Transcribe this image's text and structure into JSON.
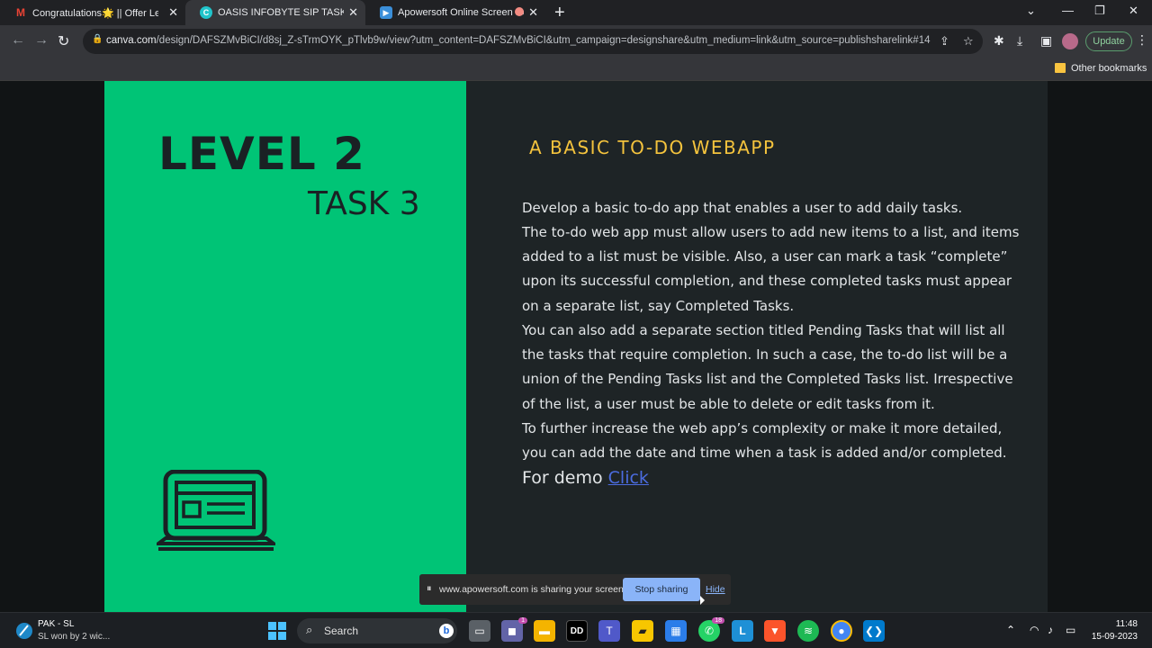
{
  "browser": {
    "tabs": [
      {
        "title": "Congratulations🌟 || Offer Letter",
        "icon": "gmail-icon",
        "active": false
      },
      {
        "title": "OASIS INFOBYTE SIP TASK LIST",
        "icon": "canva-icon",
        "active": true
      },
      {
        "title": "Apowersoft Online Screen Re",
        "icon": "apowersoft-icon",
        "active": false
      }
    ],
    "url_host": "canva.com",
    "url_path": "/design/DAFSZMvBiCI/d8sj_Z-sTrmOYK_pTlvb9w/view?utm_content=DAFSZMvBiCI&utm_campaign=designshare&utm_medium=link&utm_source=publishsharelink#14",
    "update_label": "Update",
    "bookmark_label": "Other bookmarks"
  },
  "slide": {
    "level": "LEVEL 2",
    "task": "TASK 3",
    "title": "A BASIC TO-DO WEBAPP",
    "paragraphs": [
      " Develop a basic to-do app that enables a user to add daily tasks.",
      "The to-do web app must allow users to add new items to a list, and items added to a list must be visible. Also, a user can mark a task “complete” upon its successful completion, and these completed tasks must appear on a separate list, say Completed Tasks.",
      "You can also add a separate section titled Pending Tasks that will list all the tasks that require completion. In such a case, the to-do list will be a union of the Pending Tasks list and the Completed Tasks list. Irrespective of the list, a user must be able to delete or edit tasks from it.",
      "To further increase the web app’s complexity or make it more detailed, you can add the date and time when a task is added and/or completed."
    ],
    "demo_label": "For demo ",
    "demo_link": "Click",
    "colors": {
      "left_panel": "#00c476",
      "right_panel": "#1e2426",
      "title": "#f4c33d",
      "link": "#4b6ce0"
    }
  },
  "share_bar": {
    "message": "www.apowersoft.com is sharing your screen.",
    "stop_label": "Stop sharing",
    "hide_label": "Hide"
  },
  "taskbar": {
    "news_title": "PAK - SL",
    "news_sub": "SL won by 2 wic...",
    "search_label": "Search",
    "teams_badge": "1",
    "whatsapp_badge": "18",
    "time": "11:48",
    "date": "15-09-2023"
  }
}
